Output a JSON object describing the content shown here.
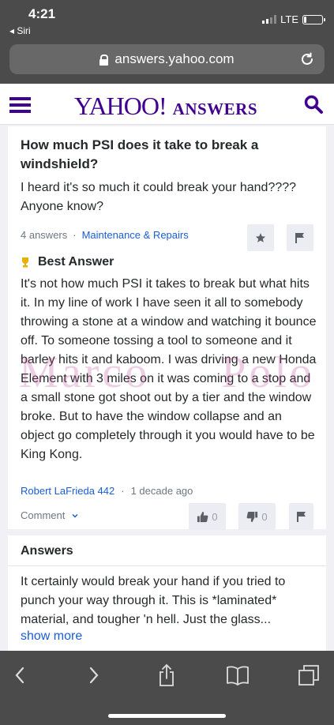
{
  "status": {
    "time": "4:21",
    "back_app": "◂ Siri",
    "network": "LTE",
    "battery_level": 0.15
  },
  "browser": {
    "url": "answers.yahoo.com",
    "lock_icon": "lock-icon",
    "reload_icon": "reload-icon"
  },
  "header": {
    "logo_yahoo": "YAHOO!",
    "logo_answers": "ANSWERS",
    "menu_icon": "hamburger-icon",
    "search_icon": "search-icon",
    "brand_color": "#400090"
  },
  "question": {
    "title": "How much PSI does it take to break a windshield?",
    "body": "I heard it's so much it could break your hand???? Anyone know?",
    "answers_count": "4 answers",
    "separator": "·",
    "category": "Maintenance & Repairs"
  },
  "best_answer": {
    "label": "Best Answer",
    "body": "It's not how much PSI it takes to break but what hits it. In my line of work I have seen it all to somebody throwing a stone at a window and watching it bounce off. To someone tossing a tool to someone and it barley hits it and kaboom. I was driving a new Honda Element with 3 miles on it was coming to a stop and a small stone got shoot out by a tier and the window broke. But to have the window collapse and an object go completely through it you would have to be King Kong.",
    "author": "Robert LaFrieda 442",
    "separator": "·",
    "time": "1 decade ago",
    "comment_label": "Comment",
    "thumbs_up": "0",
    "thumbs_down": "0"
  },
  "answers": {
    "heading": "Answers",
    "first_text": "It certainly would break your hand if you tried to punch your way through it. This is *laminated* material, and tougher 'n hell. Just the glass...",
    "show_more": "show more"
  },
  "watermark": {
    "word1": "Marco",
    "word2": "Polo"
  },
  "colors": {
    "link": "#1a5dd6",
    "chrome": "#4b4b4b",
    "button_bg": "#ececf3"
  }
}
